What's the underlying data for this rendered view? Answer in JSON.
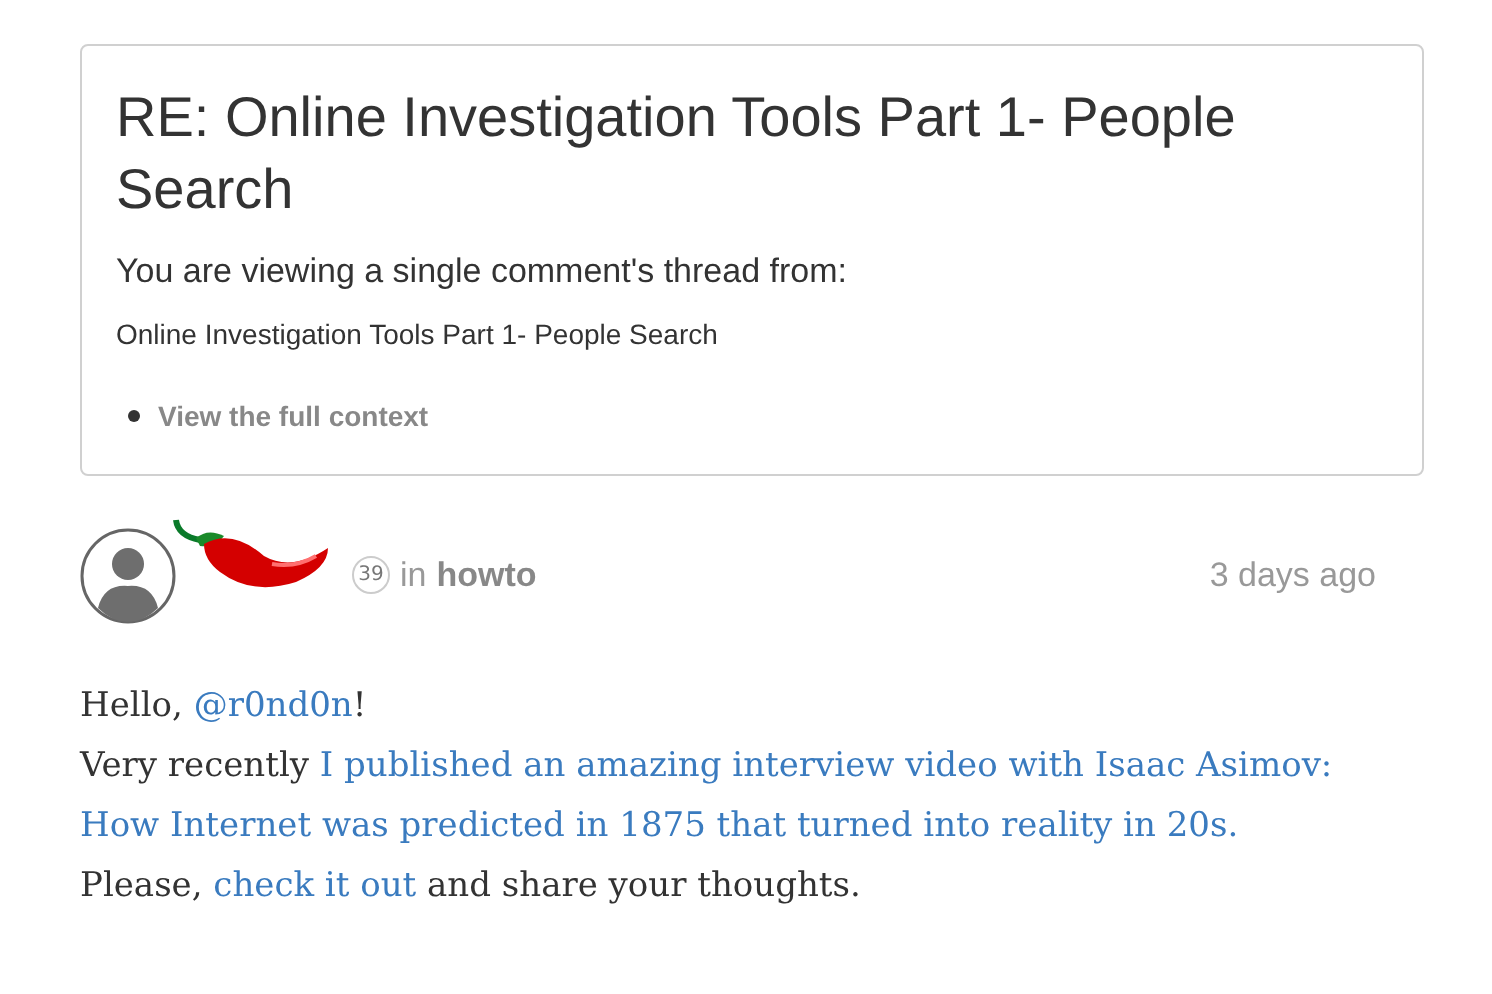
{
  "thread_card": {
    "title": "RE: Online Investigation Tools Part 1- People Search",
    "subtitle": "You are viewing a single comment's thread from:",
    "parent_post": "Online Investigation Tools Part 1- People Search",
    "context_link": "View the full context"
  },
  "comment": {
    "reputation": "39",
    "in_label": "in",
    "community": "howto",
    "time": "3 days ago",
    "lines": [
      [
        {
          "kind": "text",
          "text": "Hello, "
        },
        {
          "kind": "link",
          "text": "@r0nd0n"
        },
        {
          "kind": "text",
          "text": "!"
        }
      ],
      [
        {
          "kind": "text",
          "text": "Very recently "
        },
        {
          "kind": "link",
          "text": "I published an amazing interview video with Isaac Asimov:"
        }
      ],
      [
        {
          "kind": "link",
          "text": "How Internet was predicted in 1875 that turned into reality in 20s."
        }
      ],
      [
        {
          "kind": "text",
          "text": "Please, "
        },
        {
          "kind": "link",
          "text": "check it out"
        },
        {
          "kind": "text",
          "text": " and share your thoughts."
        }
      ]
    ]
  }
}
